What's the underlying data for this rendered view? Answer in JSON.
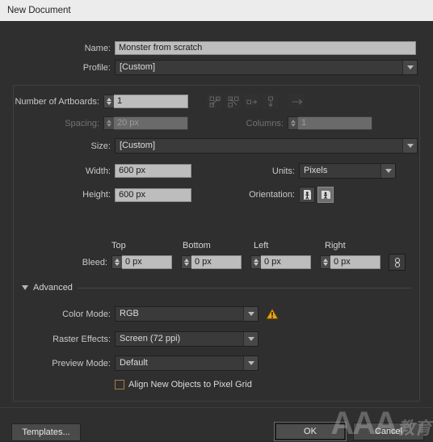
{
  "window": {
    "title": "New Document"
  },
  "form": {
    "name": {
      "label": "Name:",
      "value": "Monster from scratch"
    },
    "profile": {
      "label": "Profile:",
      "value": "[Custom]"
    },
    "artboards": {
      "label": "Number of Artboards:",
      "value": "1",
      "layout_buttons": [
        {
          "name": "grid-by-row-icon",
          "enabled": false
        },
        {
          "name": "grid-by-column-icon",
          "enabled": false
        },
        {
          "name": "arrange-by-row-icon",
          "enabled": false
        },
        {
          "name": "arrange-by-column-icon",
          "enabled": false
        }
      ],
      "direction_button": {
        "name": "right-to-left-arrow-icon",
        "enabled": false
      }
    },
    "spacing": {
      "label": "Spacing:",
      "value": "20 px",
      "enabled": false
    },
    "columns": {
      "label": "Columns:",
      "value": "1",
      "enabled": false
    },
    "size": {
      "label": "Size:",
      "value": "[Custom]"
    },
    "width": {
      "label": "Width:",
      "value": "600 px"
    },
    "height": {
      "label": "Height:",
      "value": "600 px"
    },
    "units": {
      "label": "Units:",
      "value": "Pixels"
    },
    "orientation": {
      "label": "Orientation:",
      "options": [
        "portrait",
        "landscape"
      ],
      "selected": "landscape"
    },
    "bleed": {
      "label": "Bleed:",
      "headers": {
        "top": "Top",
        "bottom": "Bottom",
        "left": "Left",
        "right": "Right"
      },
      "values": {
        "top": "0 px",
        "bottom": "0 px",
        "left": "0 px",
        "right": "0 px"
      },
      "link_icon": "link-chain-icon"
    },
    "advanced": {
      "label": "Advanced",
      "expanded": true,
      "color_mode": {
        "label": "Color Mode:",
        "value": "RGB",
        "warning_icon": "warning-triangle-icon"
      },
      "raster_effects": {
        "label": "Raster Effects:",
        "value": "Screen (72 ppi)"
      },
      "preview_mode": {
        "label": "Preview Mode:",
        "value": "Default"
      },
      "align_pixel_grid": {
        "label": "Align New Objects to Pixel Grid",
        "checked": false
      }
    }
  },
  "footer": {
    "templates": "Templates...",
    "ok": "OK",
    "cancel": "Cancel"
  },
  "watermark": {
    "latin": "AAA",
    "cjk": "教育"
  },
  "colors": {
    "dialog_bg": "#2f2f2f",
    "titlebar_bg": "#ececec",
    "field_bg": "#bdbdbd",
    "accent_warning": "#e8a317",
    "checkbox_border": "#a9803c"
  }
}
